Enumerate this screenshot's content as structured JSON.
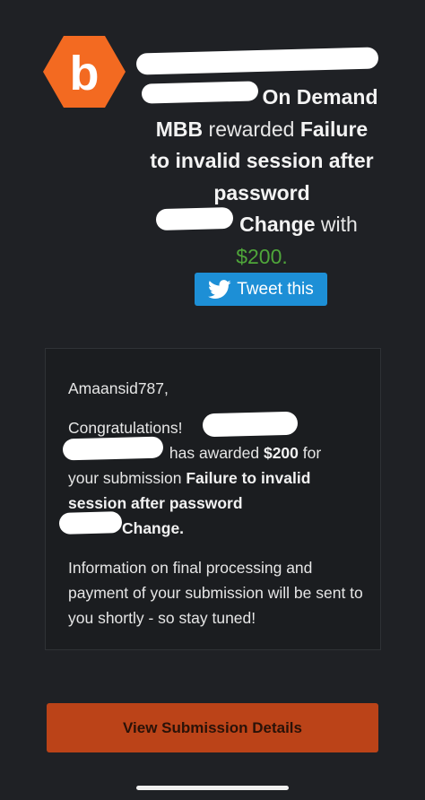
{
  "logo": {
    "letter": "b",
    "hex_color": "#f36a21"
  },
  "headline": {
    "part_on_demand": "On Demand",
    "part_mbb": "MBB",
    "part_rewarded": "rewarded",
    "part_title_1": "Failure",
    "part_title_2": "to invalid session after",
    "part_title_3": "password",
    "part_change": "Change",
    "part_with": "with",
    "amount": "$200."
  },
  "tweet_button": {
    "label": "Tweet this",
    "icon": "twitter-bird-icon"
  },
  "message": {
    "greeting": "Amaansid787,",
    "congrats": "Congratulations!",
    "has_awarded": "has awarded",
    "amount": "$200",
    "for_text": "for",
    "your_submission": "your submission",
    "submission_title": "Failure to invalid session after password",
    "change": "Change.",
    "info": "Information on final processing and payment of your submission will be sent to you shortly - so stay tuned!"
  },
  "cta": {
    "label": "View Submission Details"
  },
  "colors": {
    "background": "#1f2125",
    "accent_orange": "#bb4318",
    "twitter_blue": "#1d8fd6",
    "amount_green": "#4fa63a"
  }
}
